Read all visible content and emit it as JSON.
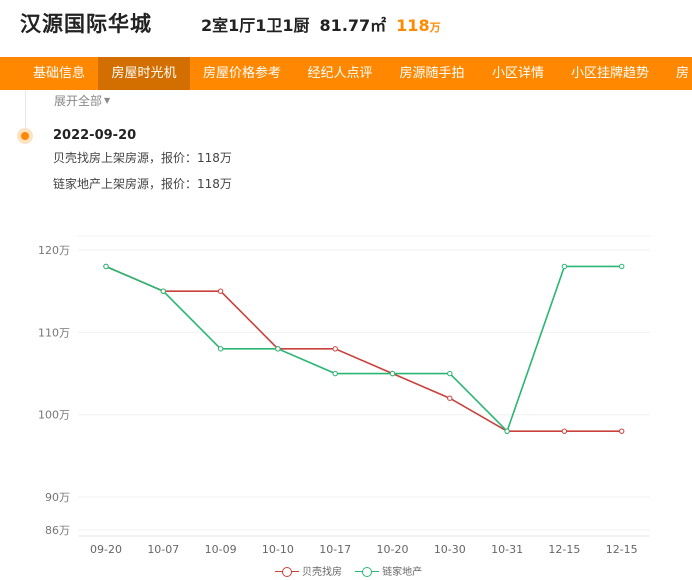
{
  "header": {
    "title": "汉源国际华城",
    "layout": "2室1厅1卫1厨",
    "area": "81.77㎡",
    "price": "118",
    "price_unit": "万"
  },
  "nav": {
    "items": [
      {
        "label": "基础信息",
        "active": false
      },
      {
        "label": "房屋时光机",
        "active": true
      },
      {
        "label": "房屋价格参考",
        "active": false
      },
      {
        "label": "经纪人点评",
        "active": false
      },
      {
        "label": "房源随手拍",
        "active": false
      },
      {
        "label": "小区详情",
        "active": false
      },
      {
        "label": "小区挂牌趋势",
        "active": false
      },
      {
        "label": "房",
        "active": false
      }
    ]
  },
  "timeline": {
    "expand_label": "展开全部",
    "event": {
      "date": "2022-09-20",
      "lines": [
        "贝壳找房上架房源，报价：118万",
        "链家地产上架房源，报价：118万"
      ]
    }
  },
  "colors": {
    "accent": "#ff8800",
    "nav_active": "#d26f00",
    "series_beike": "#c9413d",
    "series_lianjia": "#2bb673"
  },
  "chart_data": {
    "type": "line",
    "categories": [
      "09-20",
      "10-07",
      "10-09",
      "10-10",
      "10-17",
      "10-20",
      "10-30",
      "10-31",
      "12-15",
      "12-15"
    ],
    "y_ticks": [
      86,
      90,
      100,
      110,
      120
    ],
    "y_tick_labels": [
      "86万",
      "90万",
      "100万",
      "110万",
      "120万"
    ],
    "ylim": [
      86,
      122
    ],
    "grid": true,
    "legend_position": "bottom",
    "series": [
      {
        "name": "贝壳找房",
        "color": "#c9413d",
        "values": [
          118,
          115,
          115,
          108,
          108,
          105,
          102,
          98,
          98,
          98
        ]
      },
      {
        "name": "链家地产",
        "color": "#2bb673",
        "values": [
          118,
          115,
          108,
          108,
          105,
          105,
          105,
          98,
          118,
          118
        ]
      }
    ]
  }
}
